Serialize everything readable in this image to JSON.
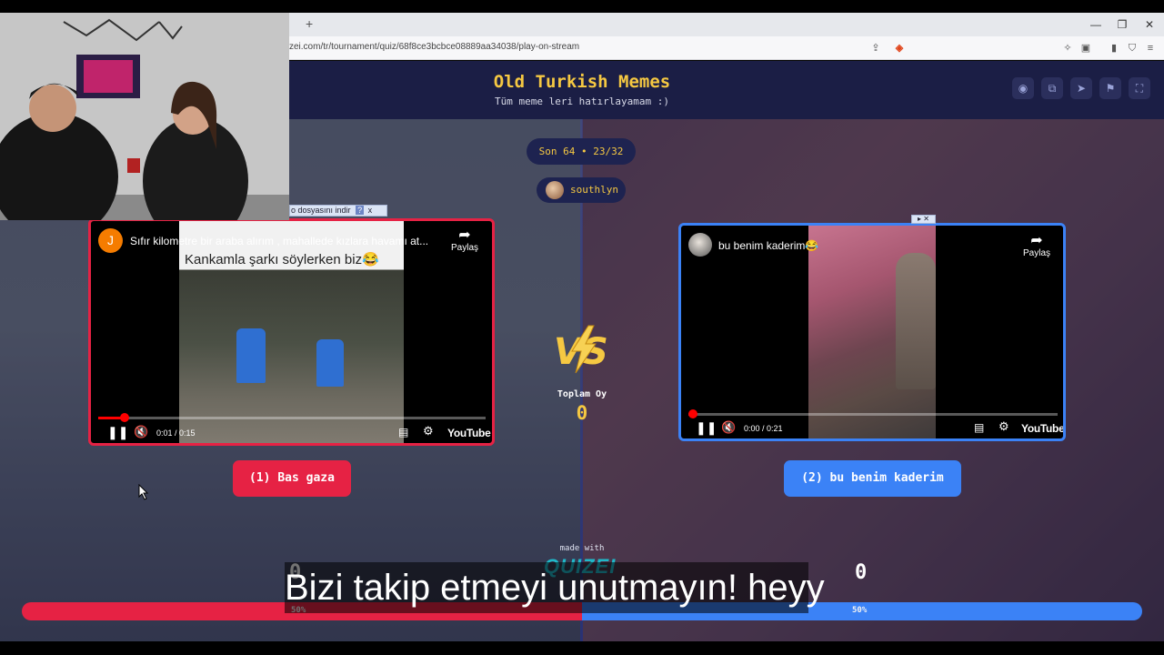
{
  "browser": {
    "new_tab_icon": "plus-icon",
    "url": "zei.com/tr/tournament/quiz/68f8ce3bcbce08889aa34038/play-on-stream",
    "window_controls": [
      "minimize-icon",
      "maximize-icon",
      "close-icon"
    ]
  },
  "header": {
    "title": "Old Turkish Memes",
    "subtitle": "Tüm meme leri hatırlayamam :)",
    "buttons": [
      "eye-icon",
      "share-icon",
      "send-icon",
      "flag-icon",
      "fullscreen-icon"
    ]
  },
  "round": {
    "label": "Son 64 • 23/32"
  },
  "streamer": {
    "name": "southlyn"
  },
  "left": {
    "channel_initial": "J",
    "video_title": "Sıfır kilometre bir araba alırım , mahallede kızlara havamı at...",
    "share_label": "Paylaş",
    "overlay_caption": "Kankamla şarkı söylerken biz😂",
    "time": "0:01 / 0:15",
    "progress": 0.067,
    "choice_label": "(1) Bas gaza",
    "score": "0",
    "percent": "50%",
    "vote_share": 50
  },
  "right": {
    "video_title": "bu benim kaderim😂",
    "share_label": "Paylaş",
    "time": "0:00 / 0:21",
    "progress": 0.0,
    "choice_label": "(2) bu benim kaderim",
    "score": "0",
    "percent": "50%",
    "vote_share": 50
  },
  "totals": {
    "label": "Toplam Oy",
    "value": "0"
  },
  "branding": {
    "made_with": "made with",
    "name": "QUIZEI"
  },
  "youtube_label": "YouTube",
  "ad": {
    "text": "o dosyasını indir",
    "help": "?",
    "close": "x"
  },
  "caption": {
    "text": "Bizi takip etmeyi unutmayın! heyy"
  },
  "colors": {
    "left_accent": "#e62244",
    "right_accent": "#3b82f6",
    "title_yellow": "#f5c842",
    "page_bg": "#1b1f44"
  }
}
